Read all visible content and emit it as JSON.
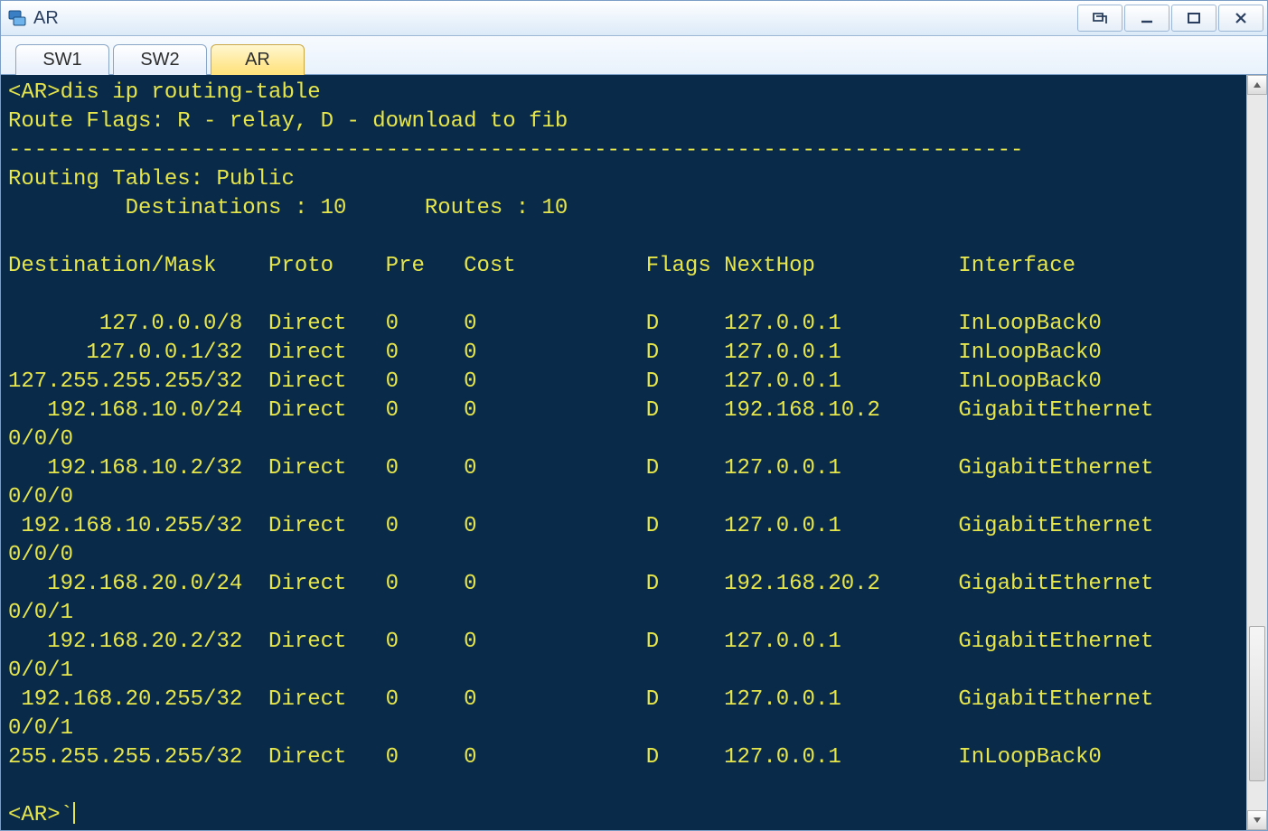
{
  "window": {
    "title": "AR"
  },
  "tabs": [
    {
      "label": "SW1",
      "active": false
    },
    {
      "label": "SW2",
      "active": false
    },
    {
      "label": "AR",
      "active": true
    }
  ],
  "terminal": {
    "prompt_open": "<AR>",
    "command": "dis ip routing-table",
    "flags_legend": "Route Flags: R - relay, D - download to fib",
    "tables_label": "Routing Tables: Public",
    "destinations_label": "Destinations : 10",
    "routes_label": "Routes : 10",
    "columns": {
      "c1": "Destination/Mask",
      "c2": "Proto",
      "c3": "Pre",
      "c4": "Cost",
      "c5": "Flags",
      "c6": "NextHop",
      "c7": "Interface"
    },
    "rows": [
      {
        "dest": "127.0.0.0/8",
        "proto": "Direct",
        "pre": "0",
        "cost": "0",
        "flags": "D",
        "nexthop": "127.0.0.1",
        "iface": "InLoopBack0"
      },
      {
        "dest": "127.0.0.1/32",
        "proto": "Direct",
        "pre": "0",
        "cost": "0",
        "flags": "D",
        "nexthop": "127.0.0.1",
        "iface": "InLoopBack0"
      },
      {
        "dest": "127.255.255.255/32",
        "proto": "Direct",
        "pre": "0",
        "cost": "0",
        "flags": "D",
        "nexthop": "127.0.0.1",
        "iface": "InLoopBack0"
      },
      {
        "dest": "192.168.10.0/24",
        "proto": "Direct",
        "pre": "0",
        "cost": "0",
        "flags": "D",
        "nexthop": "192.168.10.2",
        "iface": "GigabitEthernet",
        "iface_suffix": "0/0/0"
      },
      {
        "dest": "192.168.10.2/32",
        "proto": "Direct",
        "pre": "0",
        "cost": "0",
        "flags": "D",
        "nexthop": "127.0.0.1",
        "iface": "GigabitEthernet",
        "iface_suffix": "0/0/0"
      },
      {
        "dest": "192.168.10.255/32",
        "proto": "Direct",
        "pre": "0",
        "cost": "0",
        "flags": "D",
        "nexthop": "127.0.0.1",
        "iface": "GigabitEthernet",
        "iface_suffix": "0/0/0"
      },
      {
        "dest": "192.168.20.0/24",
        "proto": "Direct",
        "pre": "0",
        "cost": "0",
        "flags": "D",
        "nexthop": "192.168.20.2",
        "iface": "GigabitEthernet",
        "iface_suffix": "0/0/1"
      },
      {
        "dest": "192.168.20.2/32",
        "proto": "Direct",
        "pre": "0",
        "cost": "0",
        "flags": "D",
        "nexthop": "127.0.0.1",
        "iface": "GigabitEthernet",
        "iface_suffix": "0/0/1"
      },
      {
        "dest": "192.168.20.255/32",
        "proto": "Direct",
        "pre": "0",
        "cost": "0",
        "flags": "D",
        "nexthop": "127.0.0.1",
        "iface": "GigabitEthernet",
        "iface_suffix": "0/0/1"
      },
      {
        "dest": "255.255.255.255/32",
        "proto": "Direct",
        "pre": "0",
        "cost": "0",
        "flags": "D",
        "nexthop": "127.0.0.1",
        "iface": "InLoopBack0"
      }
    ],
    "prompt_after": "<AR>`"
  }
}
